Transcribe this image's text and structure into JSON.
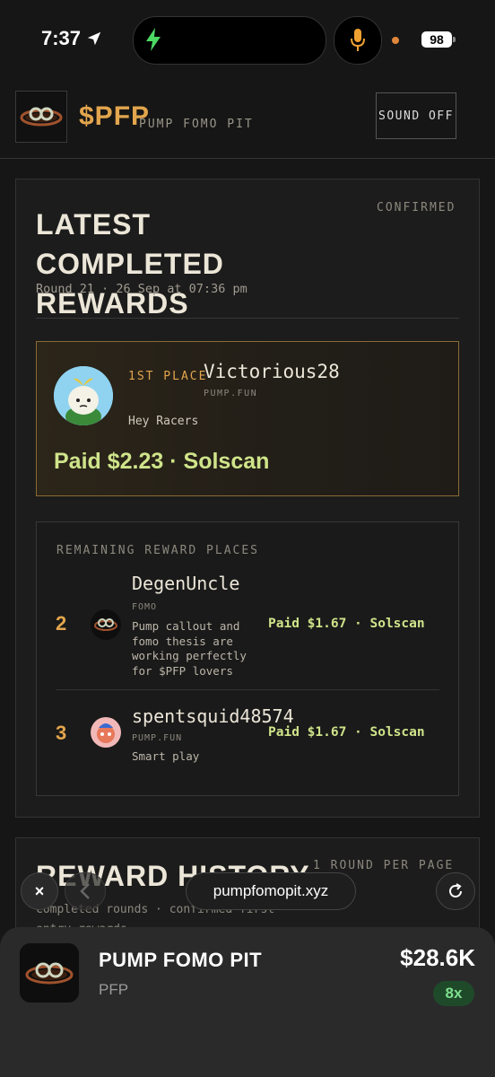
{
  "status_bar": {
    "time": "7:37",
    "battery": "98",
    "icons": [
      "location-arrow-icon",
      "bolt-icon",
      "microphone-icon",
      "battery-icon"
    ]
  },
  "header": {
    "brand_symbol": "$PFP",
    "brand_name": "PUMP FOMO PIT",
    "sound_button": "SOUND OFF"
  },
  "latest": {
    "title": "LATEST COMPLETED REWARDS",
    "status": "CONFIRMED",
    "round_info": "Round 21 · 26 Sep at 07:36 pm",
    "first": {
      "place": "1ST PLACE",
      "user": "Victorious28",
      "platform": "PUMP.FUN",
      "message": "Hey Racers",
      "paid": "Paid $2.23 · Solscan"
    },
    "remaining_title": "REMAINING REWARD PLACES",
    "rows": [
      {
        "place": "2",
        "user": "DegenUncle",
        "platform": "FOMO",
        "message": "Pump callout and fomo thesis are working perfectly for $PFP lovers",
        "paid": "Paid $1.67 · Solscan"
      },
      {
        "place": "3",
        "user": "spentsquid48574",
        "platform": "PUMP.FUN",
        "message": "Smart play",
        "paid": "Paid $1.67 · Solscan"
      }
    ]
  },
  "history": {
    "title": "REWARD HISTORY",
    "per_page": "1 ROUND PER PAGE",
    "description": "Completed rounds · confirmed first entry rewards"
  },
  "browser": {
    "close": "×",
    "url": "pumpfomopit.xyz"
  },
  "token": {
    "name": "PUMP FOMO PIT",
    "symbol": "PFP",
    "price": "$28.6K",
    "multiplier": "8x"
  },
  "colors": {
    "accent": "#e2a54d",
    "paid_green": "#cfe48a",
    "background": "#161616"
  }
}
